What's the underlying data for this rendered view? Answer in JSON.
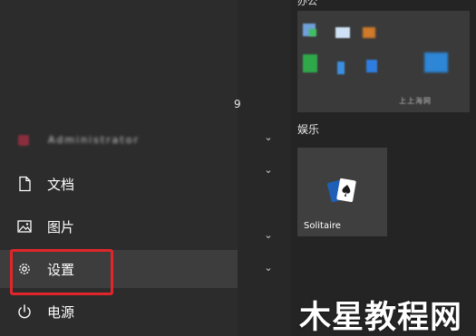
{
  "start_menu": {
    "alpha_marker": "9",
    "user": {
      "name": "Administrator"
    },
    "items": [
      {
        "label": "文档",
        "icon": "document-icon"
      },
      {
        "label": "图片",
        "icon": "pictures-icon"
      },
      {
        "label": "设置",
        "icon": "gear-icon"
      },
      {
        "label": "电源",
        "icon": "power-icon"
      }
    ]
  },
  "tiles": {
    "groups": [
      {
        "title": "办公",
        "labels": [
          "",
          "上上海网"
        ]
      },
      {
        "title": "娱乐",
        "tiles": [
          {
            "label": "Solitaire",
            "icon": "solitaire-cards-icon"
          }
        ]
      }
    ]
  },
  "watermark": "木星教程网",
  "colors": {
    "highlight": "#e1262b",
    "pane_background": "#2c2c2c",
    "tile_background": "#3f3f3f"
  }
}
